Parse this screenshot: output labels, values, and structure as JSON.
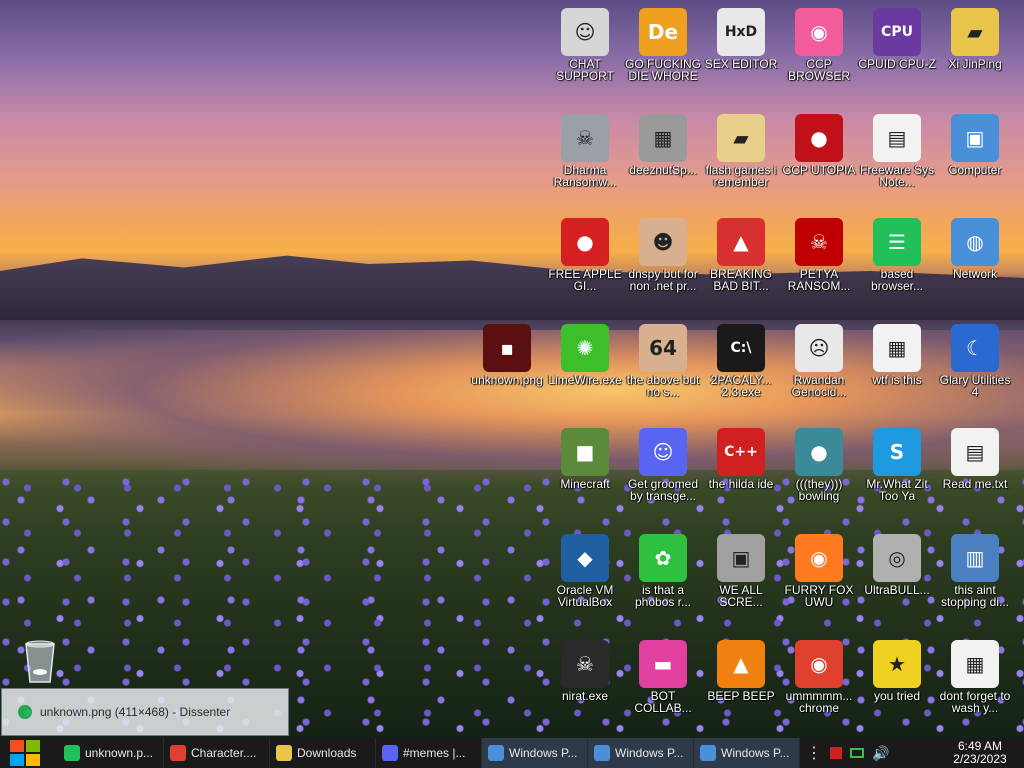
{
  "desktop": {
    "icons": [
      {
        "label": "CHAT SUPPORT",
        "icon": "doctor-icon",
        "color": "#d6d6d6"
      },
      {
        "label": "GO FUCKING DIE WHORE",
        "icon": "de-logo-icon",
        "color": "#f0a020"
      },
      {
        "label": "SEX EDITOR",
        "icon": "hxd-icon",
        "color": "#e8e8e8"
      },
      {
        "label": "CCP BROWSER",
        "icon": "browser-icon",
        "color": "#f25c9a"
      },
      {
        "label": "CPUID CPU-Z",
        "icon": "cpu-z-icon",
        "color": "#6a3aa0"
      },
      {
        "label": "Xi JinPing",
        "icon": "folder-user-icon",
        "color": "#e8c54a"
      },
      {
        "label": "Dharma Ransomw...",
        "icon": "skull-ring-icon",
        "color": "#9aa0a6"
      },
      {
        "label": "deeznutSp...",
        "icon": "stack-icon",
        "color": "#9a9a9a"
      },
      {
        "label": "flash games i remember",
        "icon": "folder-icon",
        "color": "#e8d08a"
      },
      {
        "label": "CCP UTOPIA",
        "icon": "circle-icon",
        "color": "#c0101a"
      },
      {
        "label": "Freeware Sys Note...",
        "icon": "document-icon",
        "color": "#f2f2f2"
      },
      {
        "label": "Computer",
        "icon": "computer-icon",
        "color": "#4a90d9"
      },
      {
        "label": "FREE APPLE GI...",
        "icon": "apple-icon",
        "color": "#d42020"
      },
      {
        "label": "dnspy but for non .net pr...",
        "icon": "portrait-icon",
        "color": "#d8b090"
      },
      {
        "label": "BREAKING BAD BIT...",
        "icon": "angry-bird-icon",
        "color": "#d83030"
      },
      {
        "label": "PETYA RANSOM...",
        "icon": "skull-icon",
        "color": "#c00000"
      },
      {
        "label": "based browser...",
        "icon": "chat-icon",
        "color": "#22c05a"
      },
      {
        "label": "Network",
        "icon": "network-icon",
        "color": "#4a90d9"
      },
      {
        "label": "unknown.png",
        "icon": "image-icon",
        "color": "#5a1010"
      },
      {
        "label": "LimeWire.exe",
        "icon": "limewire-icon",
        "color": "#3cbf2a"
      },
      {
        "label": "the above but no s...",
        "icon": "portrait-64-icon",
        "color": "#d8b090"
      },
      {
        "label": "2PACALY... 2.3.exe",
        "icon": "terminal-icon",
        "color": "#1a1a1a"
      },
      {
        "label": "Rwandan Genocid...",
        "icon": "meme-icon",
        "color": "#e8e8e8"
      },
      {
        "label": "wtf is this",
        "icon": "calendar-doc-icon",
        "color": "#f2f2f2"
      },
      {
        "label": "Glary Utilities 4",
        "icon": "moon-icon",
        "color": "#2a6ad0"
      },
      {
        "label": "Minecraft",
        "icon": "grass-block-icon",
        "color": "#5a8a3a"
      },
      {
        "label": "Get groomed by transge...",
        "icon": "discord-icon",
        "color": "#5865f2"
      },
      {
        "label": "the hilda ide",
        "icon": "devcpp-icon",
        "color": "#d02020"
      },
      {
        "label": "(((they))) bowling",
        "icon": "bowling-icon",
        "color": "#3a8a9a"
      },
      {
        "label": "Mr.What Zit Too Ya",
        "icon": "skype-icon",
        "color": "#1e9be0"
      },
      {
        "label": "Read me.txt",
        "icon": "text-file-icon",
        "color": "#f2f2f2"
      },
      {
        "label": "Oracle VM VirtualBox",
        "icon": "virtualbox-icon",
        "color": "#2060a0"
      },
      {
        "label": "is that a phobos r...",
        "icon": "icq-icon",
        "color": "#30c040"
      },
      {
        "label": "WE ALL SCRE...",
        "icon": "pc-icon",
        "color": "#a0a0a0"
      },
      {
        "label": "FURRY FOX UWU",
        "icon": "firefox-icon",
        "color": "#ff7a20"
      },
      {
        "label": "UltraBULL...",
        "icon": "disc-icon",
        "color": "#b0b0b0"
      },
      {
        "label": "this aint stopping di...",
        "icon": "scanner-icon",
        "color": "#4a80c0"
      },
      {
        "label": "nirat.exe",
        "icon": "skull-dark-icon",
        "color": "#2a2a2a"
      },
      {
        "label": "BOT COLLAB...",
        "icon": "monitor-pink-icon",
        "color": "#e040a0"
      },
      {
        "label": "BEEP BEEP",
        "icon": "vlc-cone-icon",
        "color": "#f08010"
      },
      {
        "label": "ummmmm... chrome",
        "icon": "chrome-icon",
        "color": "#e04030"
      },
      {
        "label": "you tried",
        "icon": "star-icon",
        "color": "#f0d020"
      },
      {
        "label": "dont forget to wash y...",
        "icon": "calendar-doc-icon",
        "color": "#f2f2f2"
      }
    ],
    "recycle_bin": {
      "icon": "recycle-bin-icon"
    }
  },
  "tooltip": {
    "text": "unknown.png (411×468) - Dissenter",
    "icon": "dissenter-icon"
  },
  "taskbar": {
    "start_icon": "windows-logo-icon",
    "tasks": [
      {
        "label": "unknown.p...",
        "icon": "dissenter-icon",
        "color": "#22c05a",
        "active": false
      },
      {
        "label": "Character....",
        "icon": "chrome-icon",
        "color": "#e04030",
        "active": false
      },
      {
        "label": "Downloads",
        "icon": "folder-icon",
        "color": "#e8c54a",
        "active": false
      },
      {
        "label": "#memes |...",
        "icon": "discord-icon",
        "color": "#5865f2",
        "active": false
      },
      {
        "label": "Windows P...",
        "icon": "window-icon",
        "color": "#4a90d9",
        "active": true
      },
      {
        "label": "Windows P...",
        "icon": "window-icon",
        "color": "#4a90d9",
        "active": true
      },
      {
        "label": "Windows P...",
        "icon": "window-icon",
        "color": "#4a90d9",
        "active": true
      }
    ],
    "clock": {
      "time": "6:49 AM",
      "date": "2/23/2023"
    }
  }
}
